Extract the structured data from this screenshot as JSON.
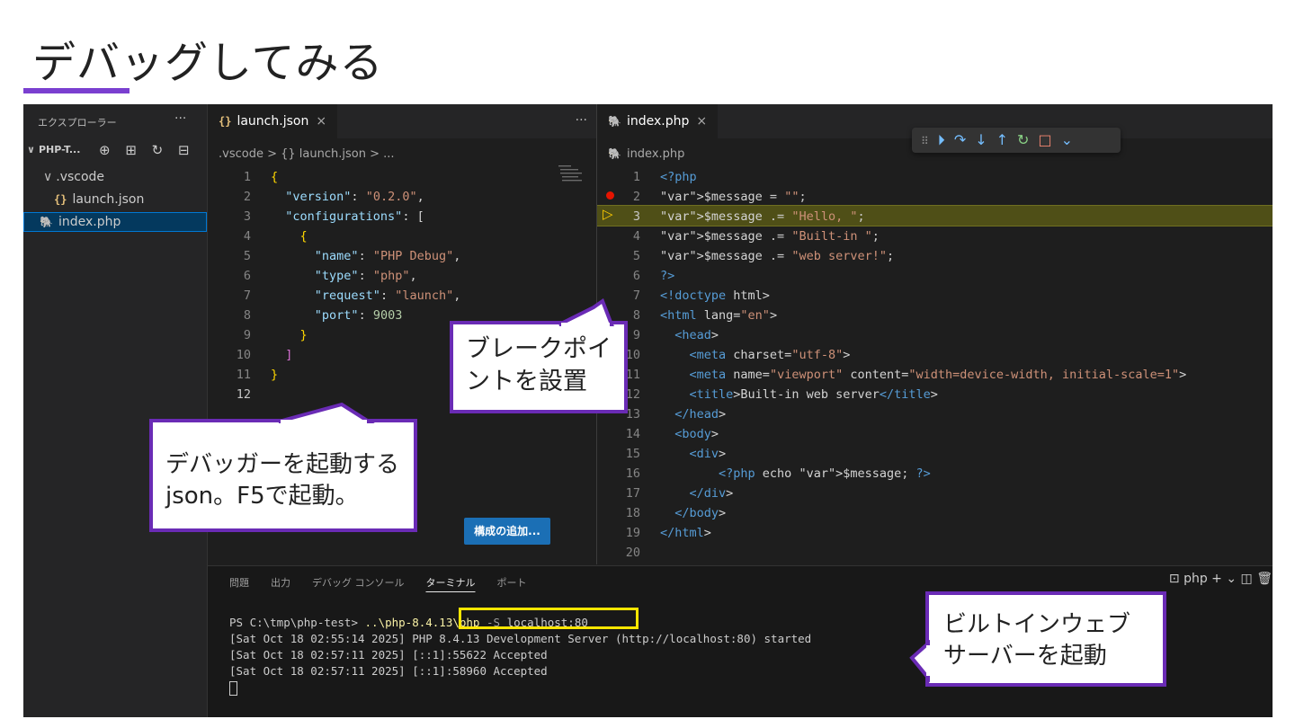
{
  "slide": {
    "title": "デバッグしてみる"
  },
  "explorer": {
    "header": "エクスプローラー",
    "more": "···",
    "project": "PHP-T...",
    "project_actions": "⊕ ⊞ ↻ ⊟",
    "tree": [
      {
        "label": ".vscode",
        "chevron": "∨"
      },
      {
        "label": "launch.json",
        "icon": "{}"
      },
      {
        "label": "index.php"
      }
    ]
  },
  "left_editor": {
    "tab": {
      "icon": "{}",
      "label": "launch.json",
      "close": "×"
    },
    "more": "···",
    "breadcrumb": ".vscode > {} launch.json > ...",
    "lines": [
      {
        "n": "1",
        "t": "{"
      },
      {
        "n": "2",
        "t": "  \"version\": \"0.2.0\","
      },
      {
        "n": "3",
        "t": "  \"configurations\": ["
      },
      {
        "n": "4",
        "t": "    {"
      },
      {
        "n": "5",
        "t": "      \"name\": \"PHP Debug\","
      },
      {
        "n": "6",
        "t": "      \"type\": \"php\","
      },
      {
        "n": "7",
        "t": "      \"request\": \"launch\","
      },
      {
        "n": "8",
        "t": "      \"port\": 9003"
      },
      {
        "n": "9",
        "t": "    }"
      },
      {
        "n": "10",
        "t": "  ]"
      },
      {
        "n": "11",
        "t": "}"
      },
      {
        "n": "12",
        "t": ""
      }
    ],
    "add_config_button": "構成の追加..."
  },
  "right_editor": {
    "tab": {
      "label": "index.php",
      "close": "×"
    },
    "breadcrumb": "index.php",
    "debug_toolbar": {
      "grip": "⠿",
      "continue": "⏵",
      "step_over": "↷",
      "step_into": "↓",
      "step_out": "↑",
      "restart": "↻",
      "stop": "□",
      "dropdown": "⌄"
    },
    "lines": [
      {
        "n": "1",
        "t": "<?php"
      },
      {
        "n": "2",
        "t": "$message = \"\";"
      },
      {
        "n": "3",
        "t": "$message .= \"Hello, \";"
      },
      {
        "n": "4",
        "t": "$message .= \"Built-in \";"
      },
      {
        "n": "5",
        "t": "$message .= \"web server!\";"
      },
      {
        "n": "6",
        "t": "?>"
      },
      {
        "n": "7",
        "t": "<!doctype html>"
      },
      {
        "n": "8",
        "t": "<html lang=\"en\">"
      },
      {
        "n": "9",
        "t": "  <head>"
      },
      {
        "n": "10",
        "t": "    <meta charset=\"utf-8\">"
      },
      {
        "n": "11",
        "t": "    <meta name=\"viewport\" content=\"width=device-width, initial-scale=1\">"
      },
      {
        "n": "12",
        "t": "    <title>Built-in web server</title>"
      },
      {
        "n": "13",
        "t": "  </head>"
      },
      {
        "n": "14",
        "t": "  <body>"
      },
      {
        "n": "15",
        "t": "    <div>"
      },
      {
        "n": "16",
        "t": "        <?php echo $message; ?>"
      },
      {
        "n": "17",
        "t": "    </div>"
      },
      {
        "n": "18",
        "t": "  </body>"
      },
      {
        "n": "19",
        "t": "</html>"
      },
      {
        "n": "20",
        "t": ""
      }
    ]
  },
  "panel": {
    "tabs": [
      "問題",
      "出力",
      "デバッグ コンソール",
      "ターミナル",
      "ポート"
    ],
    "active_tab": "ターミナル",
    "actions": "⊡ php  + ⌄  ◫  🗑",
    "terminal": [
      "[Sat Oct 18 02:55:14 2025] PHP 8.4.13 Development Server (http://localhost:80) started",
      "[Sat Oct 18 02:57:11 2025] [::1]:55622 Accepted",
      "[Sat Oct 18 02:57:11 2025] [::1]:58960 Accepted"
    ],
    "prompt": "PS C:\\tmp\\php-test> ",
    "cmd": "..\\php-8.4.13\\php",
    "arg": " -S ",
    "host": "localhost:80"
  },
  "callouts": {
    "breakpoint": "ブレークポイントを設置",
    "launch": "デバッガーを起動するjson。F5で起動。",
    "server": "ビルトインウェブサーバーを起動"
  },
  "colors": {
    "accent": "#6a2bb5",
    "highlight": "#ffe600",
    "breakpoint": "#e51400"
  }
}
